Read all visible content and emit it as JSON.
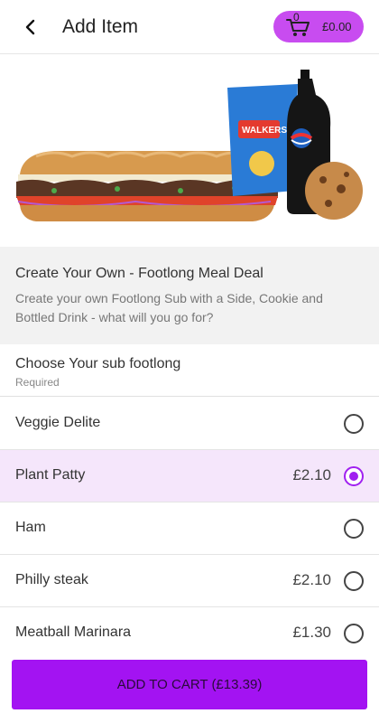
{
  "header": {
    "title": "Add Item",
    "cart_count": "0",
    "cart_total": "£0.00"
  },
  "hero": {
    "chips_brand": "WALKERS"
  },
  "meal": {
    "title": "Create Your Own - Footlong Meal Deal",
    "description": "Create your own Footlong Sub with a Side, Cookie and Bottled Drink - what will you go for?"
  },
  "choose": {
    "title": "Choose Your sub footlong",
    "required": "Required"
  },
  "options": [
    {
      "name": "Veggie Delite",
      "price": "",
      "selected": false
    },
    {
      "name": "Plant Patty",
      "price": "£2.10",
      "selected": true
    },
    {
      "name": "Ham",
      "price": "",
      "selected": false
    },
    {
      "name": "Philly steak",
      "price": "£2.10",
      "selected": false
    },
    {
      "name": "Meatball Marinara",
      "price": "£1.30",
      "selected": false
    }
  ],
  "cta": {
    "label": "ADD TO CART (£13.39)"
  },
  "colors": {
    "accent": "#a313f2",
    "cart_pill": "#c84cf0",
    "selected_row": "#f5e6fb"
  }
}
